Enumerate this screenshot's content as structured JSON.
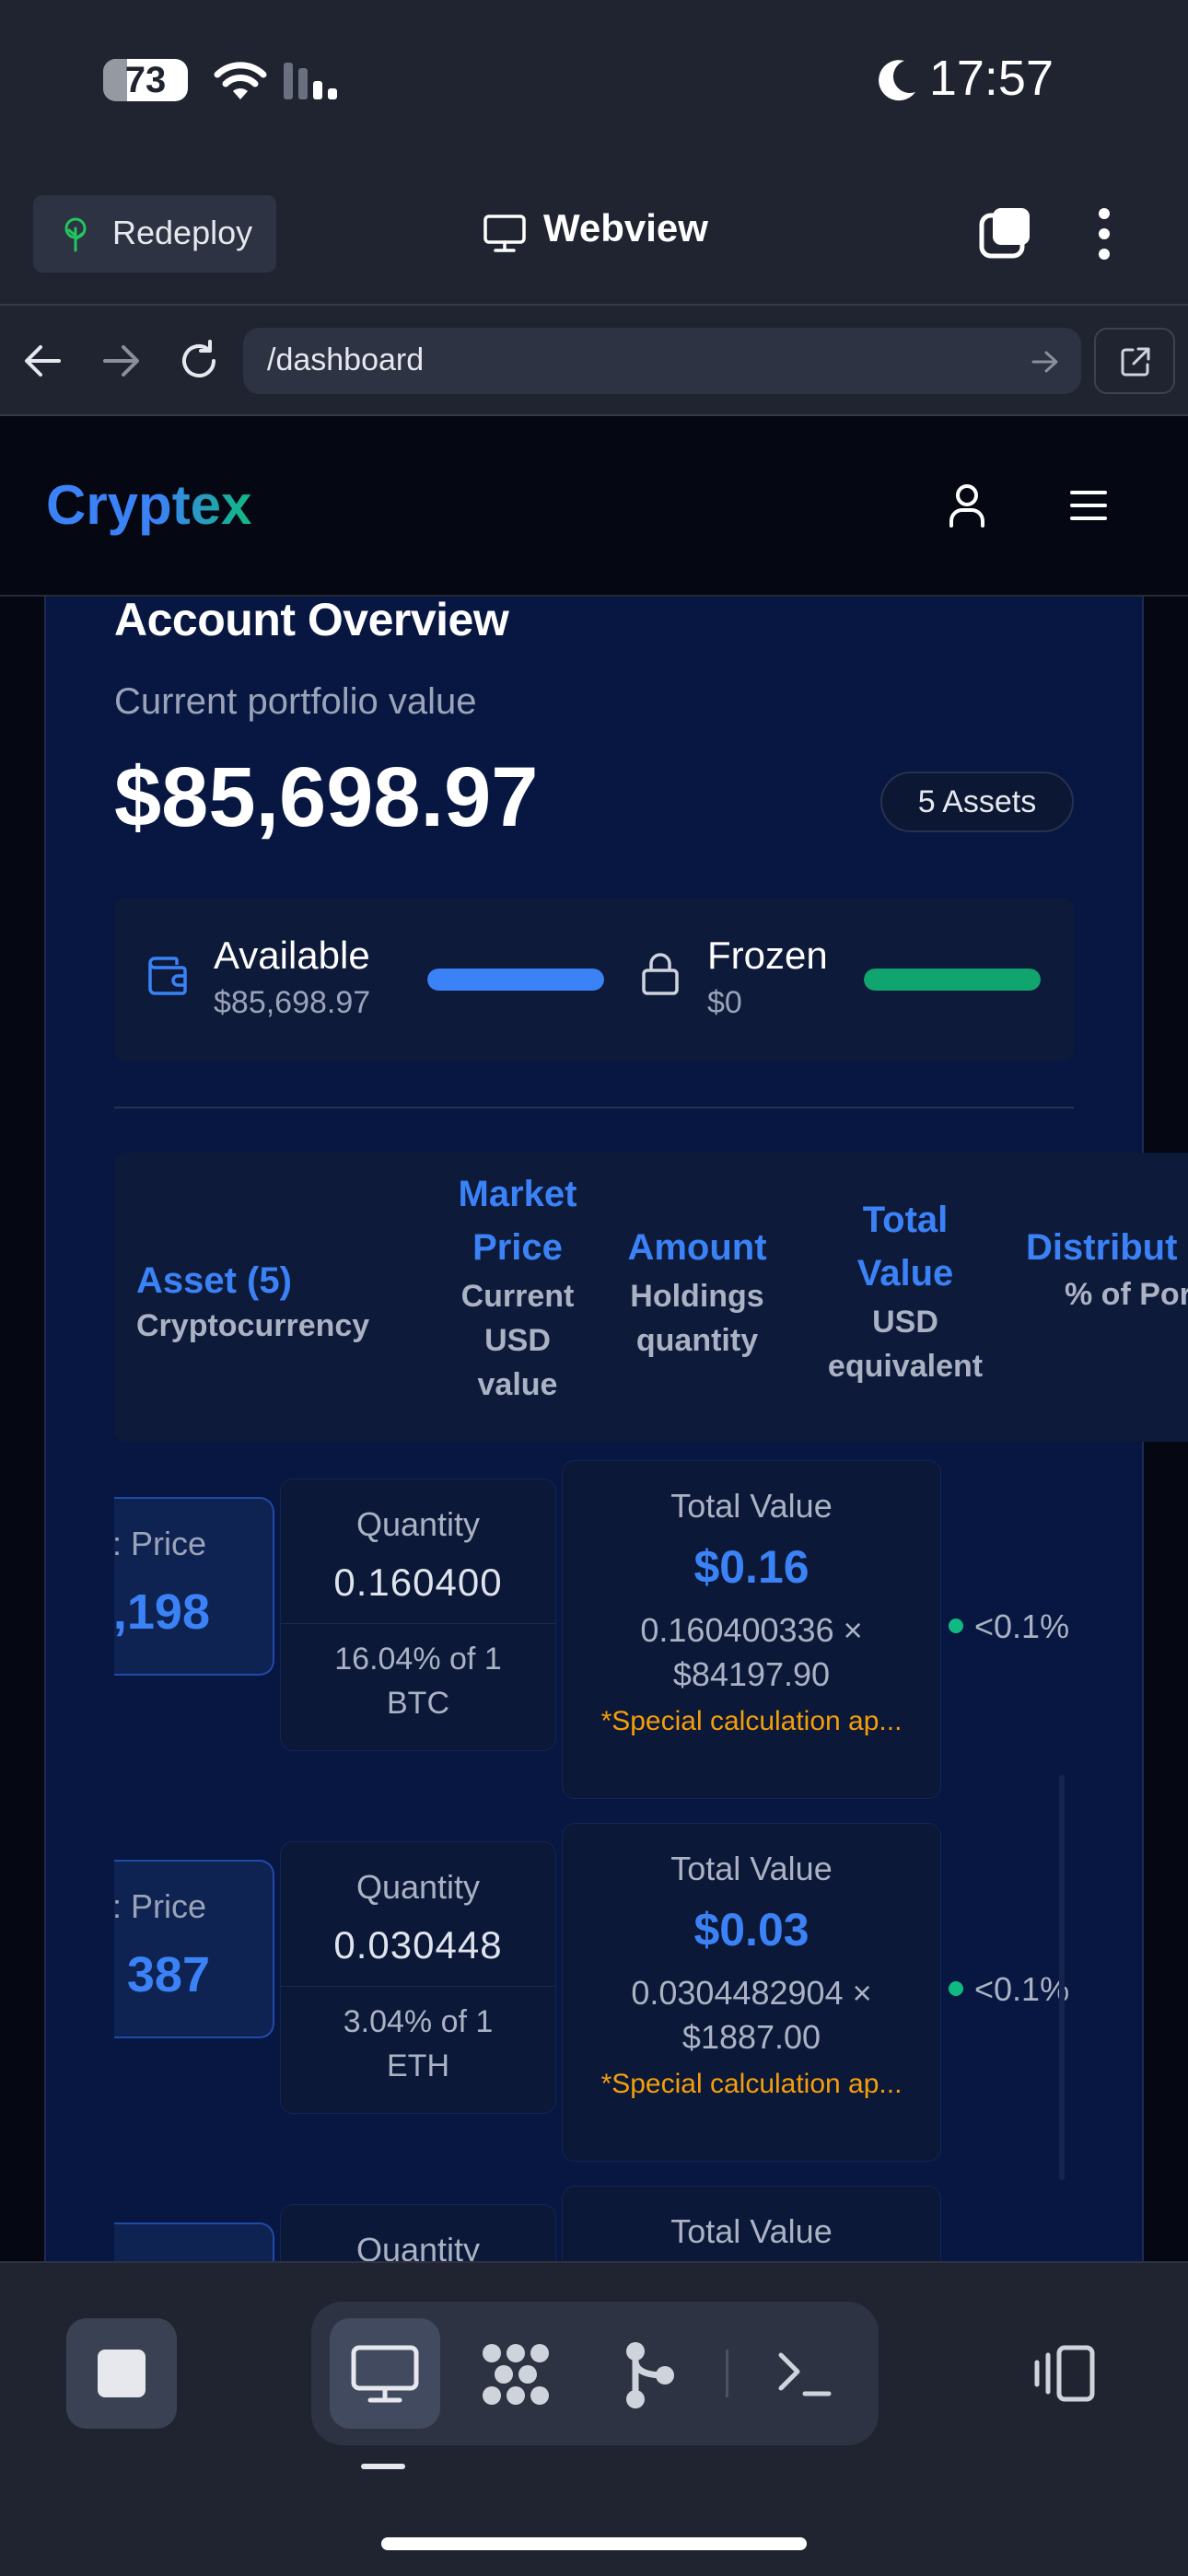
{
  "status_bar": {
    "battery": "73",
    "time": "17:57"
  },
  "browser": {
    "redeploy_label": "Redeploy",
    "title": "Webview",
    "url": "/dashboard"
  },
  "app": {
    "brand": "Cryptex"
  },
  "overview": {
    "title": "Account Overview",
    "subtitle": "Current portfolio value",
    "value": "$85,698.97",
    "assets_badge": "5 Assets",
    "available_label": "Available",
    "available_amount": "$85,698.97",
    "available_bar_fraction": 1.0,
    "frozen_label": "Frozen",
    "frozen_amount": "$0",
    "frozen_bar_fraction": 1.0,
    "colors": {
      "accent_blue": "#3b82f6",
      "accent_green": "#10b981",
      "warning": "#f59e0b"
    }
  },
  "table": {
    "columns": [
      {
        "title": "Asset (5)",
        "subtitle": "Cryptocurrency"
      },
      {
        "title": "Market Price",
        "subtitle": "Current USD value"
      },
      {
        "title": "Amount",
        "subtitle": "Holdings quantity"
      },
      {
        "title": "Total Value",
        "subtitle": "USD equivalent"
      },
      {
        "title": "Distribut",
        "subtitle": "% of Portfoli"
      }
    ],
    "rows": [
      {
        "price_label": ": Price",
        "price_value": ",198",
        "qty_label": "Quantity",
        "qty_value": "0.160400",
        "qty_pct": "16.04% of 1 BTC",
        "total_label": "Total Value",
        "total_value": "$0.16",
        "total_calc": "0.160400336 × $84197.90",
        "total_note": "*Special calculation ap...",
        "distribution": "<0.1%"
      },
      {
        "price_label": ": Price",
        "price_value": "387",
        "qty_label": "Quantity",
        "qty_value": "0.030448",
        "qty_pct": "3.04% of 1 ETH",
        "total_label": "Total Value",
        "total_value": "$0.03",
        "total_calc": "0.0304482904 × $1887.00",
        "total_note": "*Special calculation ap...",
        "distribution": "<0.1%"
      },
      {
        "qty_label": "Quantity",
        "total_label": "Total Value"
      }
    ]
  },
  "dock": {
    "tabs": [
      "desktop-icon",
      "dots-grid-icon",
      "branch-icon",
      "terminal-icon"
    ],
    "active_tab": "desktop-icon"
  }
}
